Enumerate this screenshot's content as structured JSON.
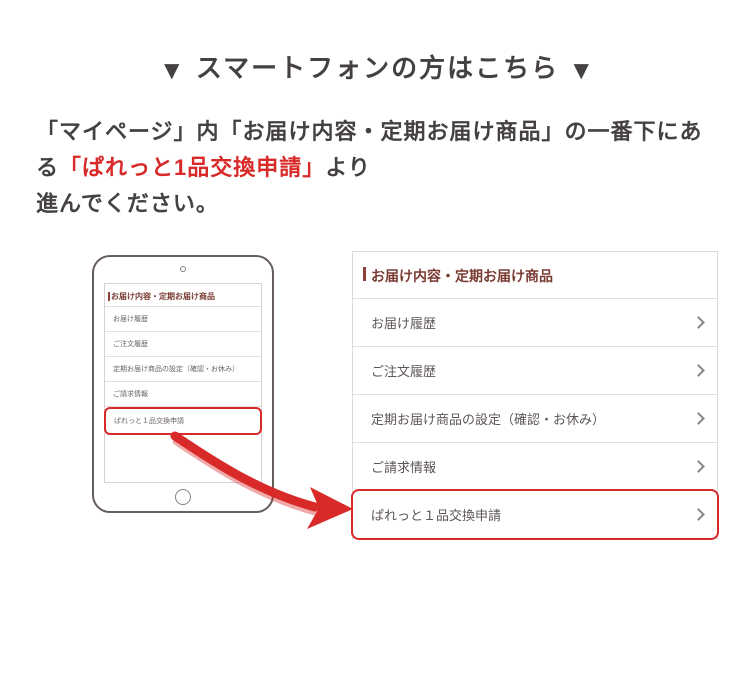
{
  "heading_text": "スマートフォンの方はこちら",
  "description": {
    "part1": "「マイページ」内「お届け内容・定期お届け商品」の一番下にある",
    "highlight": "「ぱれっと1品交換申請」",
    "part2": "より",
    "part3": "進んでください。"
  },
  "tablet_menu": {
    "section_title": "お届け内容・定期お届け商品",
    "items": [
      {
        "label": "お届け履歴"
      },
      {
        "label": "ご注文履歴"
      },
      {
        "label": "定期お届け商品の設定（確認・お休み）"
      },
      {
        "label": "ご請求情報"
      },
      {
        "label": "ぱれっと１品交換申請",
        "highlighted": true
      }
    ]
  },
  "large_menu": {
    "section_title": "お届け内容・定期お届け商品",
    "items": [
      {
        "label": "お届け履歴"
      },
      {
        "label": "ご注文履歴"
      },
      {
        "label": "定期お届け商品の設定（確認・お休み）"
      },
      {
        "label": "ご請求情報"
      },
      {
        "label": "ぱれっと１品交換申請",
        "highlighted": true
      }
    ]
  }
}
